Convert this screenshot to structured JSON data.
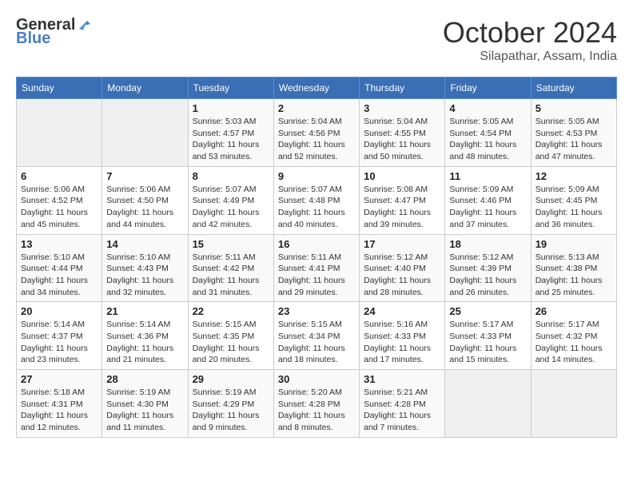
{
  "header": {
    "logo_general": "General",
    "logo_blue": "Blue",
    "title": "October 2024",
    "location": "Silapathar, Assam, India"
  },
  "weekdays": [
    "Sunday",
    "Monday",
    "Tuesday",
    "Wednesday",
    "Thursday",
    "Friday",
    "Saturday"
  ],
  "weeks": [
    [
      {
        "day": "",
        "sunrise": "",
        "sunset": "",
        "daylight": ""
      },
      {
        "day": "",
        "sunrise": "",
        "sunset": "",
        "daylight": ""
      },
      {
        "day": "1",
        "sunrise": "Sunrise: 5:03 AM",
        "sunset": "Sunset: 4:57 PM",
        "daylight": "Daylight: 11 hours and 53 minutes."
      },
      {
        "day": "2",
        "sunrise": "Sunrise: 5:04 AM",
        "sunset": "Sunset: 4:56 PM",
        "daylight": "Daylight: 11 hours and 52 minutes."
      },
      {
        "day": "3",
        "sunrise": "Sunrise: 5:04 AM",
        "sunset": "Sunset: 4:55 PM",
        "daylight": "Daylight: 11 hours and 50 minutes."
      },
      {
        "day": "4",
        "sunrise": "Sunrise: 5:05 AM",
        "sunset": "Sunset: 4:54 PM",
        "daylight": "Daylight: 11 hours and 48 minutes."
      },
      {
        "day": "5",
        "sunrise": "Sunrise: 5:05 AM",
        "sunset": "Sunset: 4:53 PM",
        "daylight": "Daylight: 11 hours and 47 minutes."
      }
    ],
    [
      {
        "day": "6",
        "sunrise": "Sunrise: 5:06 AM",
        "sunset": "Sunset: 4:52 PM",
        "daylight": "Daylight: 11 hours and 45 minutes."
      },
      {
        "day": "7",
        "sunrise": "Sunrise: 5:06 AM",
        "sunset": "Sunset: 4:50 PM",
        "daylight": "Daylight: 11 hours and 44 minutes."
      },
      {
        "day": "8",
        "sunrise": "Sunrise: 5:07 AM",
        "sunset": "Sunset: 4:49 PM",
        "daylight": "Daylight: 11 hours and 42 minutes."
      },
      {
        "day": "9",
        "sunrise": "Sunrise: 5:07 AM",
        "sunset": "Sunset: 4:48 PM",
        "daylight": "Daylight: 11 hours and 40 minutes."
      },
      {
        "day": "10",
        "sunrise": "Sunrise: 5:08 AM",
        "sunset": "Sunset: 4:47 PM",
        "daylight": "Daylight: 11 hours and 39 minutes."
      },
      {
        "day": "11",
        "sunrise": "Sunrise: 5:09 AM",
        "sunset": "Sunset: 4:46 PM",
        "daylight": "Daylight: 11 hours and 37 minutes."
      },
      {
        "day": "12",
        "sunrise": "Sunrise: 5:09 AM",
        "sunset": "Sunset: 4:45 PM",
        "daylight": "Daylight: 11 hours and 36 minutes."
      }
    ],
    [
      {
        "day": "13",
        "sunrise": "Sunrise: 5:10 AM",
        "sunset": "Sunset: 4:44 PM",
        "daylight": "Daylight: 11 hours and 34 minutes."
      },
      {
        "day": "14",
        "sunrise": "Sunrise: 5:10 AM",
        "sunset": "Sunset: 4:43 PM",
        "daylight": "Daylight: 11 hours and 32 minutes."
      },
      {
        "day": "15",
        "sunrise": "Sunrise: 5:11 AM",
        "sunset": "Sunset: 4:42 PM",
        "daylight": "Daylight: 11 hours and 31 minutes."
      },
      {
        "day": "16",
        "sunrise": "Sunrise: 5:11 AM",
        "sunset": "Sunset: 4:41 PM",
        "daylight": "Daylight: 11 hours and 29 minutes."
      },
      {
        "day": "17",
        "sunrise": "Sunrise: 5:12 AM",
        "sunset": "Sunset: 4:40 PM",
        "daylight": "Daylight: 11 hours and 28 minutes."
      },
      {
        "day": "18",
        "sunrise": "Sunrise: 5:12 AM",
        "sunset": "Sunset: 4:39 PM",
        "daylight": "Daylight: 11 hours and 26 minutes."
      },
      {
        "day": "19",
        "sunrise": "Sunrise: 5:13 AM",
        "sunset": "Sunset: 4:38 PM",
        "daylight": "Daylight: 11 hours and 25 minutes."
      }
    ],
    [
      {
        "day": "20",
        "sunrise": "Sunrise: 5:14 AM",
        "sunset": "Sunset: 4:37 PM",
        "daylight": "Daylight: 11 hours and 23 minutes."
      },
      {
        "day": "21",
        "sunrise": "Sunrise: 5:14 AM",
        "sunset": "Sunset: 4:36 PM",
        "daylight": "Daylight: 11 hours and 21 minutes."
      },
      {
        "day": "22",
        "sunrise": "Sunrise: 5:15 AM",
        "sunset": "Sunset: 4:35 PM",
        "daylight": "Daylight: 11 hours and 20 minutes."
      },
      {
        "day": "23",
        "sunrise": "Sunrise: 5:15 AM",
        "sunset": "Sunset: 4:34 PM",
        "daylight": "Daylight: 11 hours and 18 minutes."
      },
      {
        "day": "24",
        "sunrise": "Sunrise: 5:16 AM",
        "sunset": "Sunset: 4:33 PM",
        "daylight": "Daylight: 11 hours and 17 minutes."
      },
      {
        "day": "25",
        "sunrise": "Sunrise: 5:17 AM",
        "sunset": "Sunset: 4:33 PM",
        "daylight": "Daylight: 11 hours and 15 minutes."
      },
      {
        "day": "26",
        "sunrise": "Sunrise: 5:17 AM",
        "sunset": "Sunset: 4:32 PM",
        "daylight": "Daylight: 11 hours and 14 minutes."
      }
    ],
    [
      {
        "day": "27",
        "sunrise": "Sunrise: 5:18 AM",
        "sunset": "Sunset: 4:31 PM",
        "daylight": "Daylight: 11 hours and 12 minutes."
      },
      {
        "day": "28",
        "sunrise": "Sunrise: 5:19 AM",
        "sunset": "Sunset: 4:30 PM",
        "daylight": "Daylight: 11 hours and 11 minutes."
      },
      {
        "day": "29",
        "sunrise": "Sunrise: 5:19 AM",
        "sunset": "Sunset: 4:29 PM",
        "daylight": "Daylight: 11 hours and 9 minutes."
      },
      {
        "day": "30",
        "sunrise": "Sunrise: 5:20 AM",
        "sunset": "Sunset: 4:28 PM",
        "daylight": "Daylight: 11 hours and 8 minutes."
      },
      {
        "day": "31",
        "sunrise": "Sunrise: 5:21 AM",
        "sunset": "Sunset: 4:28 PM",
        "daylight": "Daylight: 11 hours and 7 minutes."
      },
      {
        "day": "",
        "sunrise": "",
        "sunset": "",
        "daylight": ""
      },
      {
        "day": "",
        "sunrise": "",
        "sunset": "",
        "daylight": ""
      }
    ]
  ]
}
